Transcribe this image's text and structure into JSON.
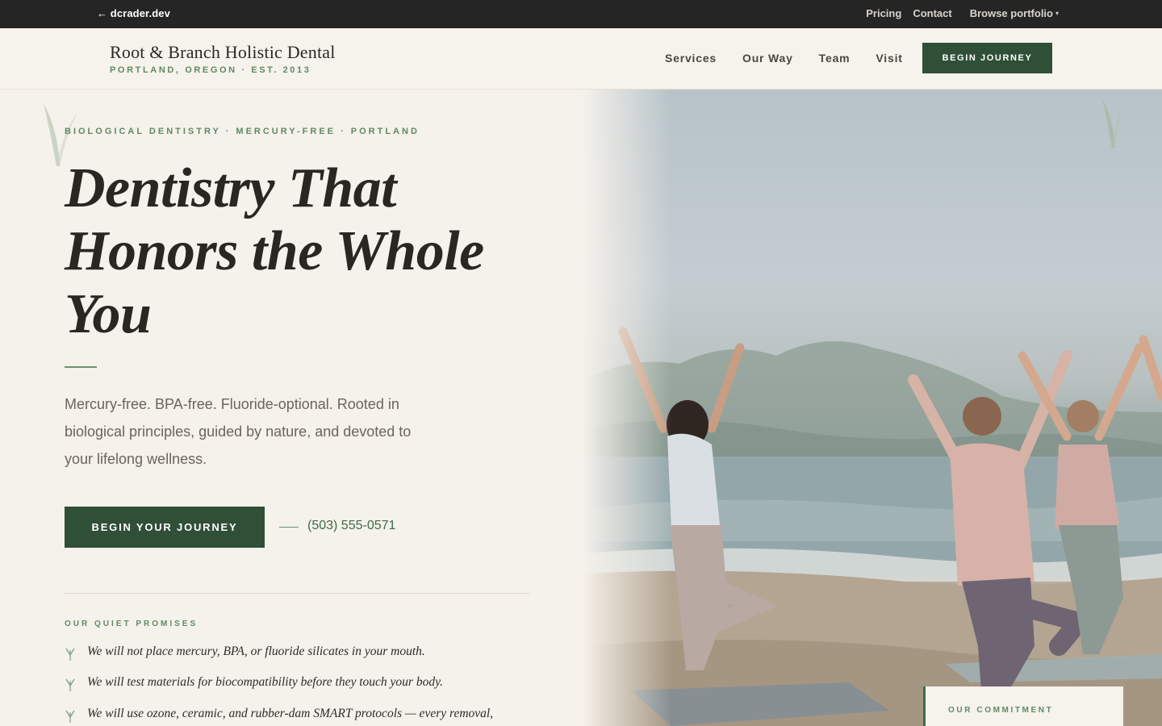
{
  "topbar": {
    "back_label": "← dcrader.dev",
    "links": [
      "Pricing",
      "Contact"
    ],
    "browse_label": "Browse portfolio",
    "browse_caret": "▾"
  },
  "header": {
    "brand_name": "Root & Branch Holistic Dental",
    "brand_sub": "PORTLAND, OREGON · EST. 2013",
    "nav": [
      "Services",
      "Our Way",
      "Team",
      "Visit"
    ],
    "cta": "BEGIN JOURNEY"
  },
  "hero": {
    "eyebrow": "BIOLOGICAL DENTISTRY · MERCURY-FREE · PORTLAND",
    "headline_lines": [
      "Dentistry That",
      "Honors the Whole",
      "You"
    ],
    "lede": "Mercury-free. BPA-free. Fluoride-optional. Rooted in biological principles, guided by nature, and devoted to your lifelong wellness.",
    "primary_button": "BEGIN YOUR JOURNEY",
    "phone": "(503) 555-0571",
    "promises_label": "OUR QUIET PROMISES",
    "promises": [
      "We will not place mercury, BPA, or fluoride silicates in your mouth.",
      "We will test materials for biocompatibility before they touch your body.",
      "We will use ozone, ceramic, and rubber-dam SMART protocols — every removal,"
    ]
  },
  "commitment": {
    "label": "OUR COMMITMENT"
  },
  "colors": {
    "forest_green": "#2f4f37",
    "sage_accent": "#5f8a64",
    "cream_bg": "#f5f1eb",
    "topbar_bg": "#252525"
  },
  "icons": {
    "back": "arrow-left-icon",
    "caret": "chevron-down-icon",
    "promise_bullet": "sprout-icon",
    "decor": "grass-blade-icon"
  }
}
